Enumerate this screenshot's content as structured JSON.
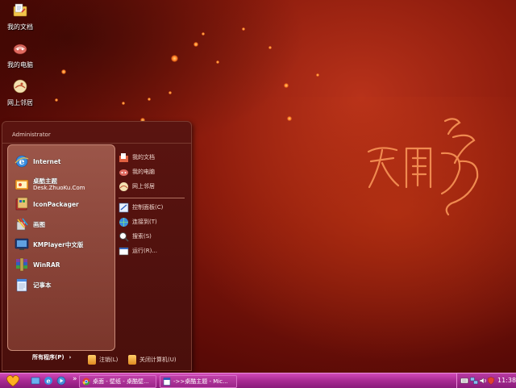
{
  "desktop": {
    "icons": [
      {
        "label": "我的文档",
        "icon": "my-documents-icon"
      },
      {
        "label": "我的电脑",
        "icon": "my-computer-icon"
      },
      {
        "label": "网上邻居",
        "icon": "network-places-icon"
      }
    ]
  },
  "start_menu": {
    "user_name": "Administrator",
    "pinned": [
      {
        "title": "Internet",
        "subtitle": "",
        "icon": "internet-explorer-icon"
      },
      {
        "title": "桌酷主题",
        "subtitle": "Desk.ZhuoKu.Com",
        "icon": "zhuoku-theme-icon"
      },
      {
        "title": "IconPackager",
        "subtitle": "",
        "icon": "iconpackager-icon"
      },
      {
        "title": "画图",
        "subtitle": "",
        "icon": "paint-icon"
      },
      {
        "title": "KMPlayer中文版",
        "subtitle": "",
        "icon": "kmplayer-icon"
      },
      {
        "title": "WinRAR",
        "subtitle": "",
        "icon": "winrar-icon"
      },
      {
        "title": "记事本",
        "subtitle": "",
        "icon": "notepad-icon"
      }
    ],
    "all_programs": "所有程序(P)",
    "all_programs_arrow": "›",
    "places": [
      {
        "label": "我的文档",
        "icon": "my-documents-icon"
      },
      {
        "label": "我的电脑",
        "icon": "my-computer-icon"
      },
      {
        "label": "网上邻居",
        "icon": "network-places-icon"
      }
    ],
    "system": [
      {
        "label": "控制面板(C)",
        "icon": "control-panel-icon"
      },
      {
        "label": "连接到(T)",
        "icon": "connect-to-icon"
      },
      {
        "label": "搜索(S)",
        "icon": "search-icon"
      },
      {
        "label": "运行(R)...",
        "icon": "run-icon"
      }
    ],
    "logoff": "注销(L)",
    "shutdown": "关闭计算机(U)"
  },
  "taskbar": {
    "tasks": [
      {
        "label": "桌面 - 壁纸 - 桌酷壁...",
        "icon": "chrome-icon"
      },
      {
        "label": "->>桌酷主题 - Mic...",
        "icon": "word-document-icon"
      }
    ],
    "quicklaunch_separator": "»",
    "clock": "11:38"
  },
  "colors": {
    "taskbar": "#b0309a",
    "wallpaper": "#8a1a0c",
    "menu_bg": "#4a0f0c"
  }
}
